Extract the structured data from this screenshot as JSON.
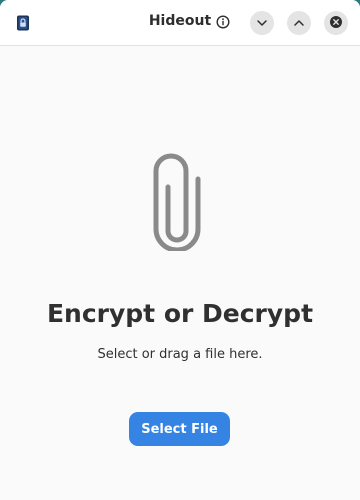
{
  "window": {
    "title": "Hideout"
  },
  "headerbar": {
    "app_icon": "app-lock-icon",
    "info_icon": "info-icon",
    "minimize_icon": "chevron-down-icon",
    "maximize_icon": "chevron-up-icon",
    "close_icon": "close-icon"
  },
  "main": {
    "status_icon": "paperclip-icon",
    "heading": "Encrypt or Decrypt",
    "subtitle": "Select or drag a file here.",
    "select_button_label": "Select File"
  },
  "colors": {
    "accent": "#3584e4",
    "icon_gray": "#8a8a8a",
    "text": "#303030"
  }
}
